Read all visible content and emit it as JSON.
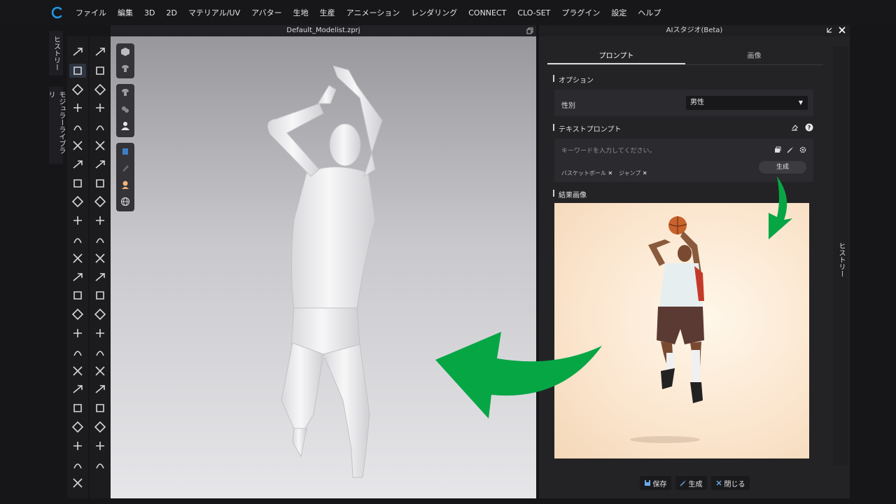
{
  "menu": [
    "ファイル",
    "編集",
    "3D",
    "2D",
    "マテリアル/UV",
    "アバター",
    "生地",
    "生産",
    "アニメーション",
    "レンダリング",
    "CONNECT",
    "CLO-SET",
    "プラグイン",
    "設定",
    "ヘルプ"
  ],
  "left_tabs": {
    "history": "ヒストリー",
    "modular": "モジュラーライブラリ"
  },
  "viewport": {
    "title": "Default_Modelist.zprj"
  },
  "panel": {
    "title": "AIスタジオ(Beta)",
    "tabs": [
      {
        "label": "プロンプト",
        "active": true
      },
      {
        "label": "画像",
        "active": false
      }
    ],
    "options_title": "オプション",
    "gender_label": "性別",
    "gender_value": "男性",
    "text_prompt_title": "テキストプロンプト",
    "prompt_placeholder": "キーワードを入力してください。",
    "tags": [
      "バスケットボール",
      "ジャンプ"
    ],
    "generate_label": "生成",
    "result_title": "結果画像",
    "buttons": {
      "save": "保存",
      "generate": "生成",
      "close": "閉じる"
    }
  },
  "right_strip": {
    "history": "ヒストリー"
  },
  "colors": {
    "accent_arrow": "#07a645",
    "logo": "#1e9be8"
  }
}
